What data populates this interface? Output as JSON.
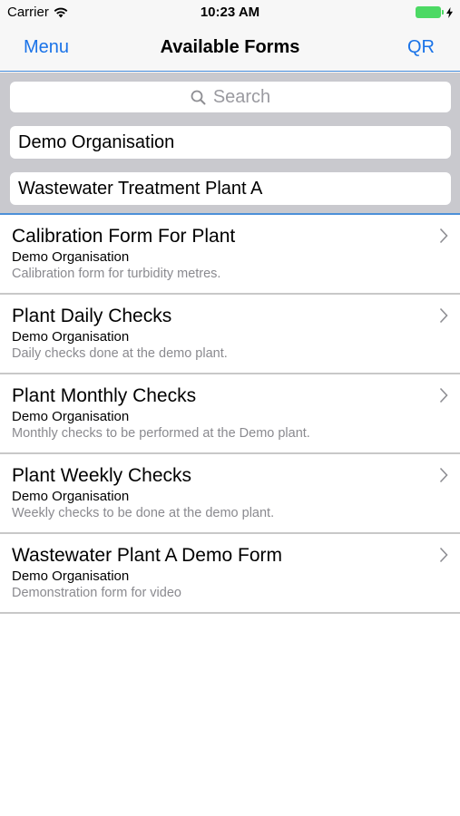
{
  "status_bar": {
    "carrier": "Carrier",
    "time": "10:23 AM"
  },
  "nav": {
    "left_label": "Menu",
    "title": "Available Forms",
    "right_label": "QR"
  },
  "filters": {
    "search_placeholder": "Search",
    "organisation": "Demo Organisation",
    "plant": "Wastewater Treatment Plant A"
  },
  "forms": [
    {
      "title": "Calibration Form For Plant",
      "organisation": "Demo Organisation",
      "description": "Calibration form for turbidity metres."
    },
    {
      "title": "Plant Daily Checks",
      "organisation": "Demo Organisation",
      "description": "Daily checks done at the demo plant."
    },
    {
      "title": "Plant Monthly Checks",
      "organisation": "Demo Organisation",
      "description": "Monthly checks to be performed at the Demo plant."
    },
    {
      "title": "Plant Weekly Checks",
      "organisation": "Demo Organisation",
      "description": "Weekly checks to be done at the demo plant."
    },
    {
      "title": "Wastewater Plant A Demo Form",
      "organisation": "Demo Organisation",
      "description": "Demonstration form for video"
    }
  ],
  "colors": {
    "accent": "#1a73e8",
    "battery": "#4cd964",
    "filter_background": "#c9c9ce"
  },
  "icons": {
    "wifi": "wifi-icon",
    "battery": "battery-icon",
    "charging": "bolt-icon",
    "search": "search-icon",
    "chevron": "chevron-right-icon"
  }
}
